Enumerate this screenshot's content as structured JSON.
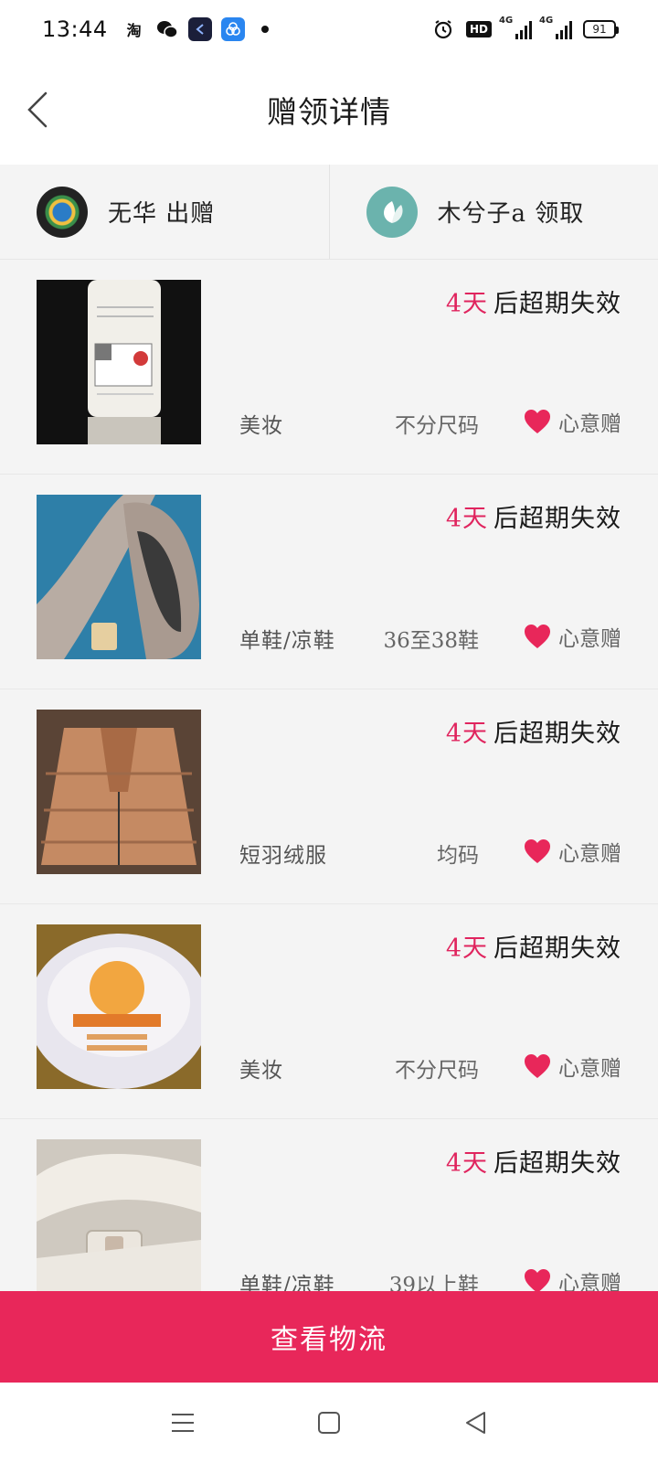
{
  "status_bar": {
    "time": "13:44",
    "left_icons": [
      "taobao-icon",
      "wechat-icon",
      "app-dark-icon",
      "app-blue-icon",
      "notification-dot"
    ],
    "right_icons": [
      "alarm-icon",
      "hd-voice-icon",
      "signal-4g-icon",
      "signal-4g-icon-2",
      "battery-icon"
    ],
    "hd_label": "HD",
    "net_label_1": "4G",
    "net_label_2": "4G",
    "battery_level": "91"
  },
  "header": {
    "title": "赠领详情",
    "back_icon": "chevron-left-icon"
  },
  "parties": {
    "giver_label": "无华 出赠",
    "receiver_label": "木兮子a 领取"
  },
  "colors": {
    "accent": "#e8275a",
    "days_red": "#e0245e",
    "list_bg": "#f4f4f4"
  },
  "items": [
    {
      "days": "4天",
      "suffix": "后超期失效",
      "category": "美妆",
      "size": "不分尺码",
      "gift_label": "心意赠",
      "image": "white-lotion-bottle"
    },
    {
      "days": "4天",
      "suffix": "后超期失效",
      "category": "单鞋/凉鞋",
      "size": "36至38鞋",
      "gift_label": "心意赠",
      "image": "beige-pumps"
    },
    {
      "days": "4天",
      "suffix": "后超期失效",
      "category": "短羽绒服",
      "size": "均码",
      "gift_label": "心意赠",
      "image": "tan-down-jacket"
    },
    {
      "days": "4天",
      "suffix": "后超期失效",
      "category": "美妆",
      "size": "不分尺码",
      "gift_label": "心意赠",
      "image": "cream-jar"
    },
    {
      "days": "4天",
      "suffix": "后超期失效",
      "category": "单鞋/凉鞋",
      "size": "39以上鞋",
      "gift_label": "心意赠",
      "image": "white-wedge-sandals"
    }
  ],
  "cta": {
    "label": "查看物流"
  },
  "nav": {
    "menu_icon": "menu-icon",
    "home_icon": "home-square-icon",
    "back_icon": "back-triangle-icon"
  }
}
